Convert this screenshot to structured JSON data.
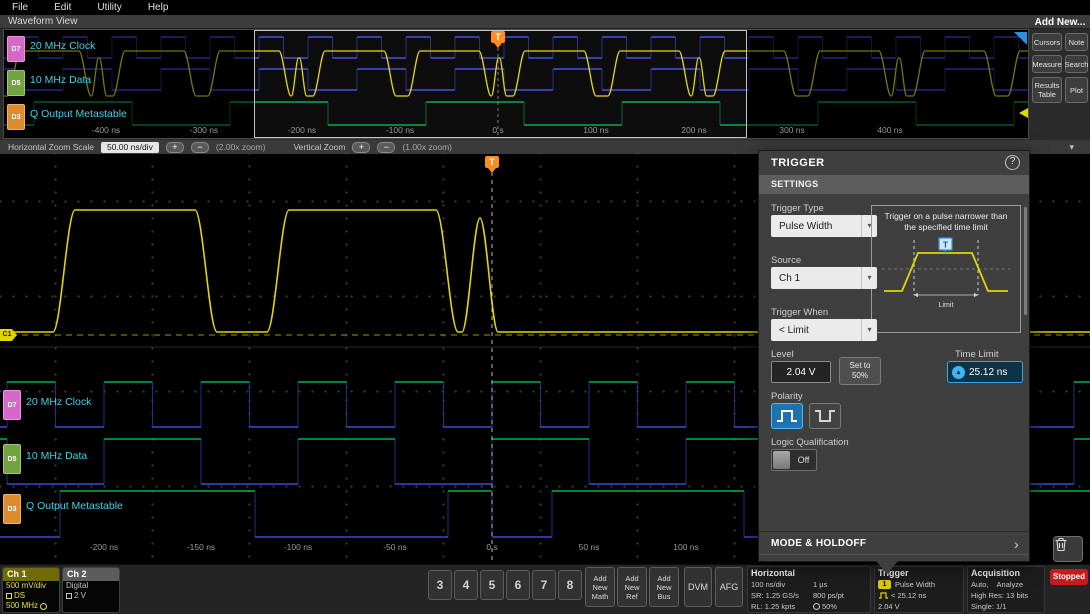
{
  "colors": {
    "ch1_yellow": "#e3d500",
    "trigger_orange": "#ff8c1e",
    "digital_high_green": "#00b350",
    "digital_low_blue": "#3d49dd",
    "accent_cyan": "#41d1e4",
    "selected_blue": "#35a7e8",
    "stopped_red": "#c41b1b",
    "d7_badge": "#d966c9",
    "d5_badge": "#71a33e",
    "d3_badge": "#e08a2e"
  },
  "menu_items": [
    "File",
    "Edit",
    "Utility",
    "Help"
  ],
  "waveform_view_title": "Waveform View",
  "trigger_marker": "T",
  "ch1_marker": "C1",
  "add_new": {
    "title": "Add New...",
    "cursors": "Cursors",
    "note": "Note",
    "measure": "Measure",
    "search": "Search",
    "results_table": "Results Table",
    "plot": "Plot"
  },
  "zoom_bar": {
    "horizontal_label": "Horizontal Zoom Scale",
    "horizontal_scale": "50.00 ns/div",
    "plus": "+",
    "minus": "−",
    "horizontal_zoom": "(2.00x zoom)",
    "vertical_label": "Vertical Zoom",
    "vertical_zoom": "(1.00x zoom)",
    "collapse": "▾"
  },
  "channels": [
    {
      "badge": "D7",
      "label": "20 MHz Clock",
      "color": "#d966c9"
    },
    {
      "badge": "D5",
      "label": "10 MHz Data",
      "color": "#71a33e"
    },
    {
      "badge": "D3",
      "label": "Q Output Metastable",
      "color": "#e08a2e"
    }
  ],
  "overview_axis": [
    "-400 ns",
    "-300 ns",
    "-200 ns",
    "-100 ns",
    "0 s",
    "100 ns",
    "200 ns",
    "300 ns",
    "400 ns"
  ],
  "main_axis": [
    "-200 ns",
    "-150 ns",
    "-100 ns",
    "-50 ns",
    "0 s",
    "50 ns",
    "100 ns"
  ],
  "trigger_panel": {
    "title": "TRIGGER",
    "settings": "SETTINGS",
    "help": "?",
    "trigger_type_label": "Trigger Type",
    "trigger_type_value": "Pulse Width",
    "description": "Trigger on a pulse narrower than the specified time limit",
    "limit_caption": "Limit",
    "source_label": "Source",
    "source_value": "Ch 1",
    "when_label": "Trigger When",
    "when_value": "< Limit",
    "level_label": "Level",
    "level_value": "2.04 V",
    "set_to": "Set to 50%",
    "time_limit_label": "Time Limit",
    "time_limit_value": "25.12 ns",
    "knob_icon": "▴",
    "polarity_label": "Polarity",
    "logic_label": "Logic Qualification",
    "logic_value": "Off",
    "mode_holdoff": "MODE & HOLDOFF",
    "chevron": "›",
    "caret": "▾"
  },
  "bottom_bar": {
    "ch1": {
      "title": "Ch 1",
      "line1": "500 mV/div",
      "line2": "DS",
      "line3": "500 MHz"
    },
    "ch2": {
      "title": "Ch 2",
      "line1": "Digital",
      "line2": "2 V"
    },
    "channel_numbers": [
      "3",
      "4",
      "5",
      "6",
      "7",
      "8"
    ],
    "add_math": [
      "Add",
      "New",
      "Math"
    ],
    "add_ref": [
      "Add",
      "New",
      "Ref"
    ],
    "add_bus": [
      "Add",
      "New",
      "Bus"
    ],
    "dvm": "DVM",
    "afg": "AFG",
    "horizontal": {
      "title": "Horizontal",
      "scale": "100 ns/div",
      "window": "1 µs",
      "sr": "SR: 1.25 GS/s",
      "res": "800 ps/pt",
      "rl": "RL: 1.25 kpts",
      "pos": "50%"
    },
    "trigger": {
      "title": "Trigger",
      "chip": "1",
      "type": "Pulse Width",
      "condition": "< 25.12 ns",
      "level": "2.04 V"
    },
    "acquisition": {
      "title": "Acquisition",
      "mode": "Auto,",
      "analyze": "Analyze",
      "line2": "High Res: 13 bits",
      "line3": "Single: 1/1"
    },
    "stopped": "Stopped"
  }
}
